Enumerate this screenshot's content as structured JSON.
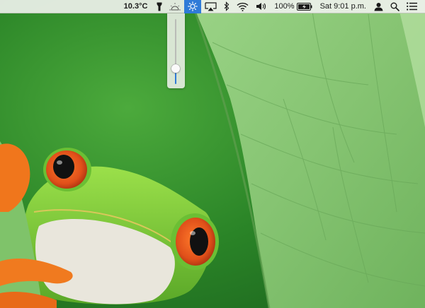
{
  "menubar": {
    "temperature": "10.3°C",
    "battery_percent": "100%",
    "clock": "Sat 9:01 p.m.",
    "icons": [
      "flashlight-icon",
      "dim-brightness-icon",
      "brightness-icon",
      "airplay-icon",
      "bluetooth-icon",
      "wifi-icon",
      "volume-icon",
      "battery-icon",
      "user-icon",
      "spotlight-search-icon",
      "notification-center-icon"
    ],
    "active_icon": "brightness-icon",
    "accent_color": "#2f7bd8"
  },
  "brightness_slider": {
    "level_fraction": 0.24
  },
  "wallpaper": {
    "description_colors": {
      "background_green": "#2e8a2a",
      "leaf_green": "#8ec97a",
      "frog_green": "#7fcf3a",
      "eye_orange": "#e0501a"
    }
  }
}
